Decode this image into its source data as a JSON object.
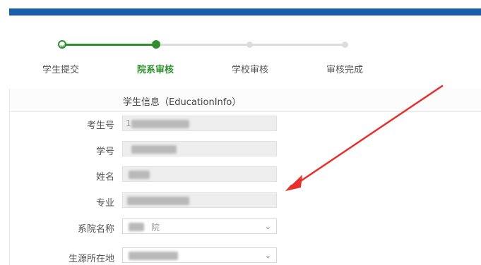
{
  "stepper": {
    "steps": [
      {
        "label": "学生提交",
        "state": "done"
      },
      {
        "label": "院系审核",
        "state": "active"
      },
      {
        "label": "学校审核",
        "state": "todo"
      },
      {
        "label": "审核完成",
        "state": "todo"
      }
    ]
  },
  "section": {
    "title": "学生信息（EducationInfo）"
  },
  "form": {
    "exam_no": {
      "label": "考生号",
      "value": "1"
    },
    "student_no": {
      "label": "学号",
      "value": ""
    },
    "name": {
      "label": "姓名",
      "value": ""
    },
    "major": {
      "label": "专业",
      "value": ""
    },
    "department": {
      "label": "系院名称",
      "value": "院"
    },
    "origin": {
      "label": "生源所在地",
      "value": ""
    }
  },
  "colors": {
    "brand_bar": "#1a5ea8",
    "step_done": "#2f8f2f",
    "annotation_arrow": "#e8302a"
  },
  "icons": {
    "step_done_icon": "check-circle",
    "select_chevron": "chevron-down-icon"
  }
}
